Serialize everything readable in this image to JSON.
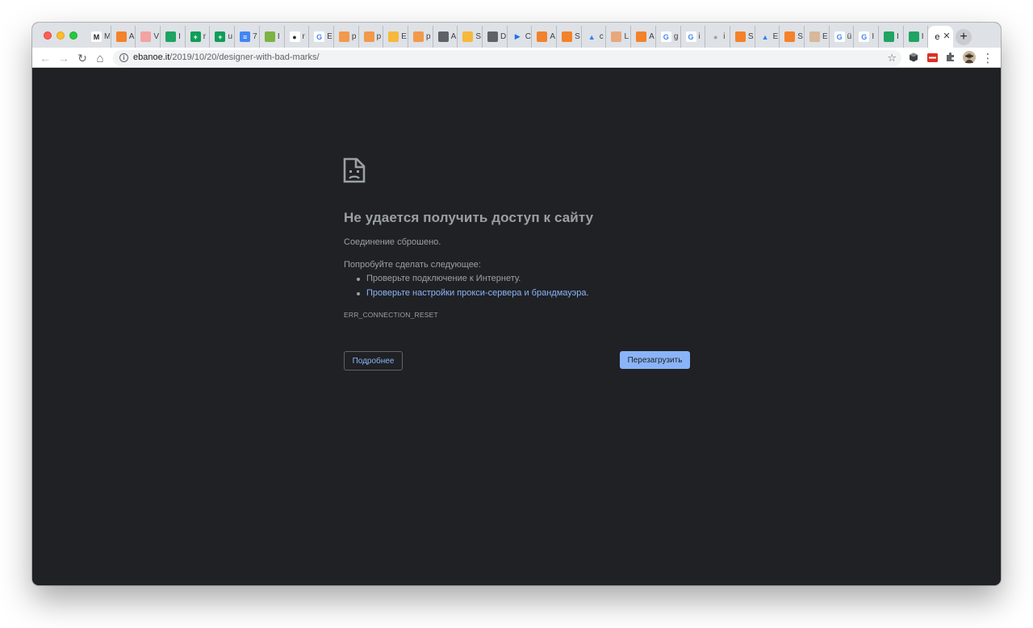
{
  "browser": {
    "tabs": [
      {
        "icon": "medium-icon",
        "color": "#ffffff",
        "glyph": "M",
        "fg": "#202124",
        "title": "M"
      },
      {
        "icon": "box-icon",
        "color": "#f4822a",
        "glyph": "",
        "fg": "#ffffff",
        "title": "A"
      },
      {
        "icon": "tab-icon",
        "color": "#f3a3a3",
        "glyph": "",
        "fg": "#ffffff",
        "title": "V"
      },
      {
        "icon": "google-drive-icon",
        "color": "#1fa463",
        "glyph": "",
        "fg": "#ffffff",
        "title": "I"
      },
      {
        "icon": "google-sheets-icon",
        "color": "#0f9d58",
        "glyph": "+",
        "fg": "#ffffff",
        "title": "r"
      },
      {
        "icon": "google-sheets-icon",
        "color": "#0f9d58",
        "glyph": "+",
        "fg": "#ffffff",
        "title": "u"
      },
      {
        "icon": "google-docs-icon",
        "color": "#4285f4",
        "glyph": "≡",
        "fg": "#ffffff",
        "title": "7"
      },
      {
        "icon": "keys-icon",
        "color": "#7cb342",
        "glyph": "",
        "fg": "#ffffff",
        "title": "I"
      },
      {
        "icon": "github-icon",
        "color": "#ffffff",
        "glyph": "●",
        "fg": "#24292e",
        "title": "r"
      },
      {
        "icon": "google-icon",
        "color": "#ffffff",
        "glyph": "G",
        "fg": "#4285f4",
        "title": "E"
      },
      {
        "icon": "figma-icon",
        "color": "#f2994a",
        "glyph": "",
        "fg": "#ffffff",
        "title": "p"
      },
      {
        "icon": "figma-icon",
        "color": "#f2994a",
        "glyph": "",
        "fg": "#ffffff",
        "title": "p"
      },
      {
        "icon": "cube-icon",
        "color": "#f6b93b",
        "glyph": "",
        "fg": "#ffffff",
        "title": "E"
      },
      {
        "icon": "figma-icon",
        "color": "#f2994a",
        "glyph": "",
        "fg": "#ffffff",
        "title": "p"
      },
      {
        "icon": "globe-icon",
        "color": "#5f6368",
        "glyph": "",
        "fg": "#ffffff",
        "title": "A"
      },
      {
        "icon": "cube-icon",
        "color": "#f6b93b",
        "glyph": "",
        "fg": "#ffffff",
        "title": "S"
      },
      {
        "icon": "globe-icon",
        "color": "#5f6368",
        "glyph": "",
        "fg": "#ffffff",
        "title": "D"
      },
      {
        "icon": "play-icon",
        "color": "#dee1e6",
        "glyph": "▶",
        "fg": "#1a73e8",
        "title": "C"
      },
      {
        "icon": "box-icon",
        "color": "#f4822a",
        "glyph": "",
        "fg": "#ffffff",
        "title": "A"
      },
      {
        "icon": "box-icon",
        "color": "#f4822a",
        "glyph": "",
        "fg": "#ffffff",
        "title": "S"
      },
      {
        "icon": "atlassian-icon",
        "color": "#dee1e6",
        "glyph": "▲",
        "fg": "#2684ff",
        "title": "c"
      },
      {
        "icon": "avatar-icon",
        "color": "#e8a87c",
        "glyph": "",
        "fg": "#ffffff",
        "title": "L"
      },
      {
        "icon": "box-icon",
        "color": "#f4822a",
        "glyph": "",
        "fg": "#ffffff",
        "title": "A"
      },
      {
        "icon": "google-icon",
        "color": "#ffffff",
        "glyph": "G",
        "fg": "#4285f4",
        "title": "g"
      },
      {
        "icon": "google-icon",
        "color": "#ffffff",
        "glyph": "G",
        "fg": "#4285f4",
        "title": "i"
      },
      {
        "icon": "apple-icon",
        "color": "#dee1e6",
        "glyph": "●",
        "fg": "#9aa0a6",
        "title": "i"
      },
      {
        "icon": "box-icon",
        "color": "#f4822a",
        "glyph": "",
        "fg": "#ffffff",
        "title": "S"
      },
      {
        "icon": "atlassian-icon",
        "color": "#dee1e6",
        "glyph": "▲",
        "fg": "#2684ff",
        "title": "E"
      },
      {
        "icon": "box-icon",
        "color": "#f4822a",
        "glyph": "",
        "fg": "#ffffff",
        "title": "S"
      },
      {
        "icon": "avatar-icon",
        "color": "#d7b899",
        "glyph": "",
        "fg": "#ffffff",
        "title": "E"
      },
      {
        "icon": "google-icon",
        "color": "#ffffff",
        "glyph": "G",
        "fg": "#4285f4",
        "title": "ü"
      },
      {
        "icon": "google-icon",
        "color": "#ffffff",
        "glyph": "G",
        "fg": "#4285f4",
        "title": "I"
      },
      {
        "icon": "google-drive-icon",
        "color": "#1fa463",
        "glyph": "",
        "fg": "#ffffff",
        "title": "I"
      },
      {
        "icon": "google-drive-icon",
        "color": "#1fa463",
        "glyph": "",
        "fg": "#ffffff",
        "title": "I"
      }
    ],
    "active_tab": {
      "title": "e",
      "close": "✕"
    },
    "new_tab": "+",
    "nav": {
      "back": "←",
      "forward": "→",
      "reload": "↻",
      "home": "⌂"
    },
    "address": {
      "host": "ebanoe.it",
      "path": "/2019/10/20/designer-with-bad-marks/",
      "info": "i",
      "bookmark": "☆"
    },
    "menu_glyph": "⋮"
  },
  "error_page": {
    "title": "Не удается получить доступ к сайту",
    "subtitle": "Соединение сброшено.",
    "try_label": "Попробуйте сделать следующее:",
    "suggestions": {
      "check_connection": "Проверьте подключение к Интернету.",
      "check_proxy": "Проверьте настройки прокси-сервера и брандмауэра."
    },
    "error_code": "ERR_CONNECTION_RESET",
    "details_button": "Подробнее",
    "reload_button": "Перезагрузить"
  }
}
